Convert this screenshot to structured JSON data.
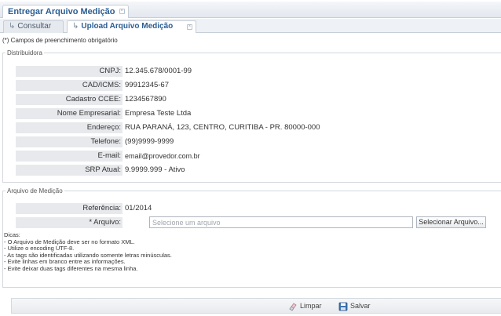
{
  "tabs": {
    "main": "Entregar Arquivo Medição",
    "consultar": "Consultar",
    "upload": "Upload Arquivo Medição"
  },
  "required_note": "(*) Campos de preenchimento obrigatório",
  "distribuidora": {
    "legend": "Distribuidora",
    "fields": [
      {
        "label": "CNPJ:",
        "value": "12.345.678/0001-99"
      },
      {
        "label": "CAD/ICMS:",
        "value": "99912345-67"
      },
      {
        "label": "Cadastro CCEE:",
        "value": "1234567890"
      },
      {
        "label": "Nome Empresarial:",
        "value": "Empresa Teste Ltda"
      },
      {
        "label": "Endereço:",
        "value": "RUA PARANÁ, 123, CENTRO, CURITIBA - PR. 80000-000"
      },
      {
        "label": "Telefone:",
        "value": "(99)9999-9999"
      },
      {
        "label": "E-mail:",
        "value": "email@provedor.com.br"
      },
      {
        "label": "SRP Atual:",
        "value": "9.9999.999 - Ativo"
      }
    ]
  },
  "arquivo": {
    "legend": "Arquivo de Medição",
    "referencia_label": "Referência:",
    "referencia_value": "01/2014",
    "arquivo_label": "* Arquivo:",
    "arquivo_value": "",
    "arquivo_placeholder": "Selecione um arquivo",
    "select_button": "Selecionar Arquivo...",
    "tips_title": "Dicas:",
    "tips": [
      "- O Arquivo de Medição deve ser no formato XML.",
      "- Utilize o encoding UTF-8.",
      "- As tags são identificadas utilizando somente letras minúsculas.",
      "- Evite linhas em branco entre as informações.",
      "- Evite deixar duas tags diferentes na mesma linha."
    ]
  },
  "actions": {
    "limpar": "Limpar",
    "salvar": "Salvar"
  },
  "icons": {
    "tab_close": "close-icon",
    "sub_tab_arrow": "arrow-right-icon",
    "limpar": "eraser-icon",
    "salvar": "floppy-disk-icon"
  },
  "colors": {
    "tab_title": "#2a5d93",
    "label_bg": "#e7e9ec"
  }
}
